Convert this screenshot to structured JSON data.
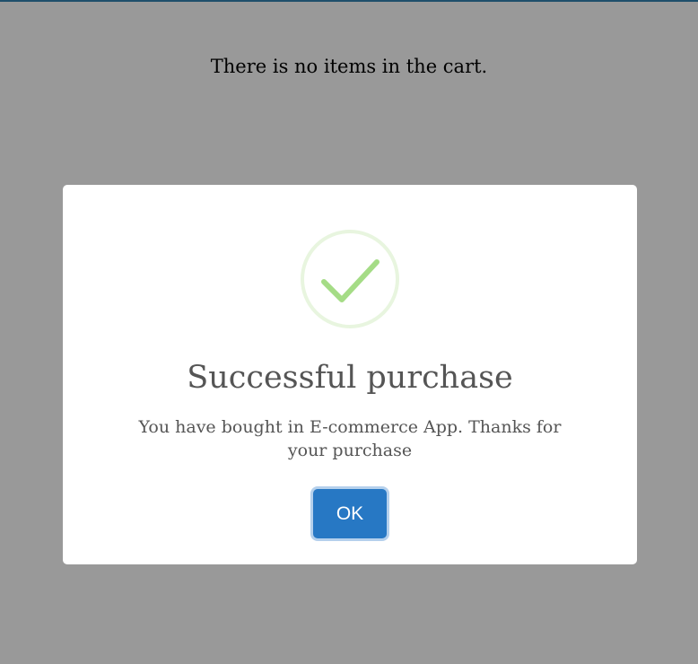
{
  "page": {
    "message": "There is no items in the cart."
  },
  "modal": {
    "icon": "success-check-icon",
    "title": "Successful purchase",
    "text": "You have bought in E-commerce App. Thanks for your purchase",
    "ok_label": "OK"
  },
  "colors": {
    "overlay": "#999999",
    "top_border": "#1f4f6b",
    "modal_background": "#ffffff",
    "success_green": "#a5dc86",
    "success_ring": "#e8f5df",
    "title_text": "#555555",
    "button_blue": "#2778c4"
  }
}
